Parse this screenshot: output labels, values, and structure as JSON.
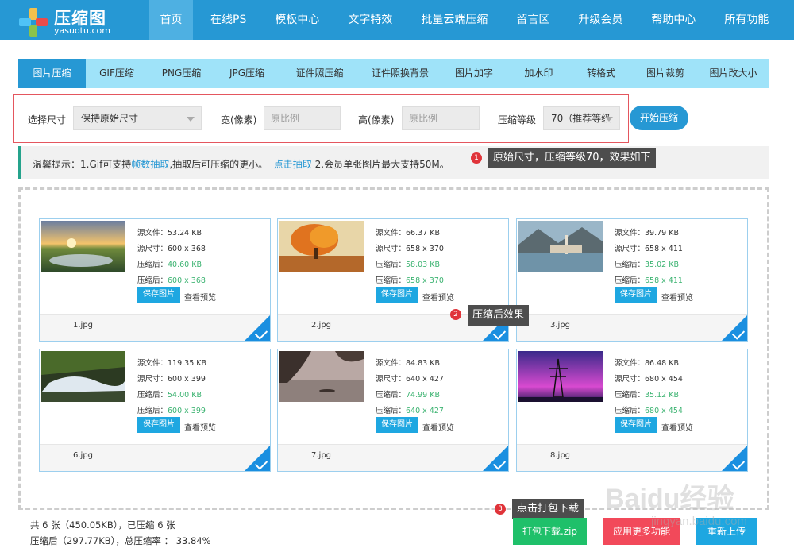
{
  "brand": {
    "title": "压缩图",
    "subtitle": "yasuotu.com"
  },
  "nav": [
    {
      "label": "首页"
    },
    {
      "label": "在线PS"
    },
    {
      "label": "模板中心"
    },
    {
      "label": "文字特效"
    },
    {
      "label": "批量云端压缩"
    },
    {
      "label": "留言区"
    },
    {
      "label": "升级会员"
    },
    {
      "label": "帮助中心"
    },
    {
      "label": "所有功能"
    }
  ],
  "tabs": [
    {
      "label": "图片压缩"
    },
    {
      "label": "GIF压缩"
    },
    {
      "label": "PNG压缩"
    },
    {
      "label": "JPG压缩"
    },
    {
      "label": "证件照压缩"
    },
    {
      "label": "证件照换背景"
    },
    {
      "label": "图片加字"
    },
    {
      "label": "加水印"
    },
    {
      "label": "转格式"
    },
    {
      "label": "图片裁剪"
    },
    {
      "label": "图片改大小"
    }
  ],
  "settings": {
    "size_label": "选择尺寸",
    "size_value": "保持原始尺寸",
    "width_label": "宽(像素)",
    "width_placeholder": "原比例",
    "height_label": "高(像素)",
    "height_placeholder": "原比例",
    "level_label": "压缩等级",
    "level_value": "70（推荐等级",
    "start_label": "开始压缩"
  },
  "tip": {
    "prefix": "温馨提示：1.Gif可支持",
    "link1": "帧数抽取",
    "mid": ",抽取后可压缩的更小。",
    "link2": "点击抽取",
    "suffix": " 2.会员单张图片最大支持50M。"
  },
  "callouts": [
    {
      "num": "1",
      "text": "原始尺寸，压缩等级70，效果如下"
    },
    {
      "num": "2",
      "text": "压缩后效果"
    },
    {
      "num": "3",
      "text": "点击打包下载"
    }
  ],
  "card_labels": {
    "src_file": "源文件：",
    "src_size": "源尺寸：",
    "after": "压缩后：",
    "save": "保存图片",
    "preview": "查看预览"
  },
  "images": [
    {
      "file": "1.jpg",
      "src_file": "53.24 KB",
      "src_size": "600 x 368",
      "out_file": "40.60 KB",
      "out_size": "600 x 368"
    },
    {
      "file": "2.jpg",
      "src_file": "66.37 KB",
      "src_size": "658 x 370",
      "out_file": "58.03 KB",
      "out_size": "658 x 370"
    },
    {
      "file": "3.jpg",
      "src_file": "39.79 KB",
      "src_size": "658 x 411",
      "out_file": "35.02 KB",
      "out_size": "658 x 411"
    },
    {
      "file": "6.jpg",
      "src_file": "119.35 KB",
      "src_size": "600 x 399",
      "out_file": "54.00 KB",
      "out_size": "600 x 399"
    },
    {
      "file": "7.jpg",
      "src_file": "84.83 KB",
      "src_size": "640 x 427",
      "out_file": "74.99 KB",
      "out_size": "640 x 427"
    },
    {
      "file": "8.jpg",
      "src_file": "86.48 KB",
      "src_size": "680 x 454",
      "out_file": "35.12 KB",
      "out_size": "680 x 454"
    }
  ],
  "summary": {
    "line1": "共 6 张（450.05KB），已压缩 6 张",
    "line2": "压缩后（297.77KB），总压缩率 ： 33.84%"
  },
  "buttons": {
    "zip": "打包下载.zip",
    "more": "应用更多功能",
    "reupload": "重新上传"
  },
  "watermark": {
    "text": "Baidu经验",
    "sub": "jingyan.baidu.com"
  },
  "colors": {
    "primary": "#2698d4",
    "tab_bar": "#9fe3f9",
    "green": "#3cb371",
    "zip_btn": "#1fc06a",
    "more_btn": "#f2495a",
    "reupload_btn": "#1ea7e1"
  }
}
